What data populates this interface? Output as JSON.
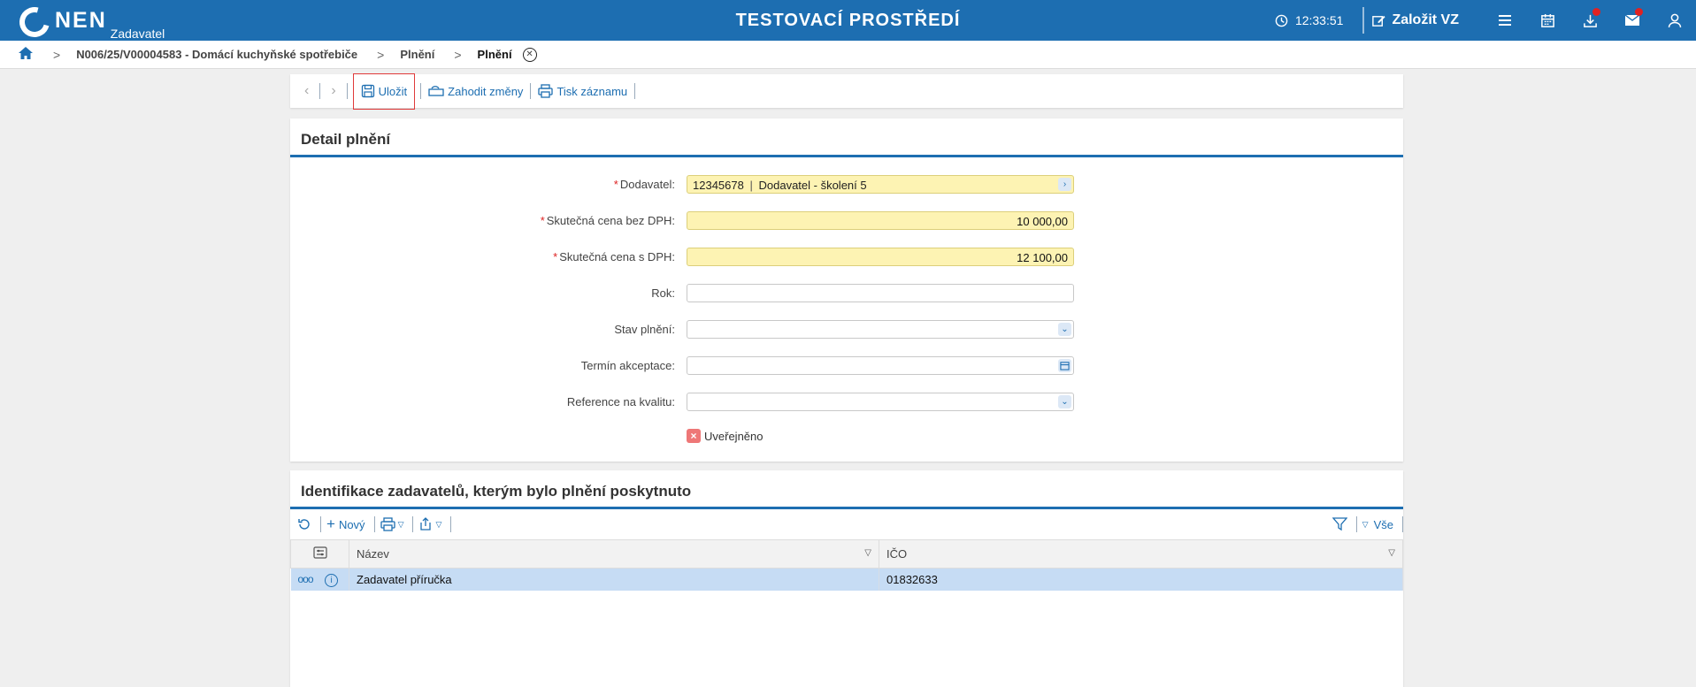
{
  "header": {
    "logo_text": "NEN",
    "logo_sub": "Zadavatel",
    "env_title": "TESTOVACÍ PROSTŘEDÍ",
    "time": "12:33:51",
    "create_label": "Založit VZ"
  },
  "breadcrumb": {
    "items": [
      "N006/25/V00004583 - Domácí kuchyňské spotřebiče",
      "Plnění",
      "Plnění"
    ]
  },
  "toolbar": {
    "save": "Uložit",
    "discard": "Zahodit změny",
    "print": "Tisk záznamu"
  },
  "detail": {
    "title": "Detail plnění",
    "fields": {
      "supplier_label": "Dodavatel:",
      "supplier_id": "12345678",
      "supplier_name": "Dodavatel - školení 5",
      "price_no_vat_label": "Skutečná cena bez DPH:",
      "price_no_vat": "10 000,00",
      "price_vat_label": "Skutečná cena s DPH:",
      "price_vat": "12 100,00",
      "year_label": "Rok:",
      "year": "",
      "state_label": "Stav plnění:",
      "state": "",
      "acceptance_label": "Termín akceptace:",
      "acceptance": "",
      "quality_label": "Reference na kvalitu:",
      "quality": "",
      "published_label": "Uveřejněno"
    }
  },
  "ident": {
    "title": "Identifikace zadavatelů, kterým bylo plnění poskytnuto",
    "new_label": "Nový",
    "all_label": "Vše",
    "columns": [
      "Název",
      "IČO"
    ],
    "rows": [
      {
        "name": "Zadavatel příručka",
        "ico": "01832633"
      }
    ]
  },
  "colors": {
    "brand": "#1d6eb1",
    "field_required": "#fdf3b3",
    "row_selected": "#c6dcf4"
  }
}
